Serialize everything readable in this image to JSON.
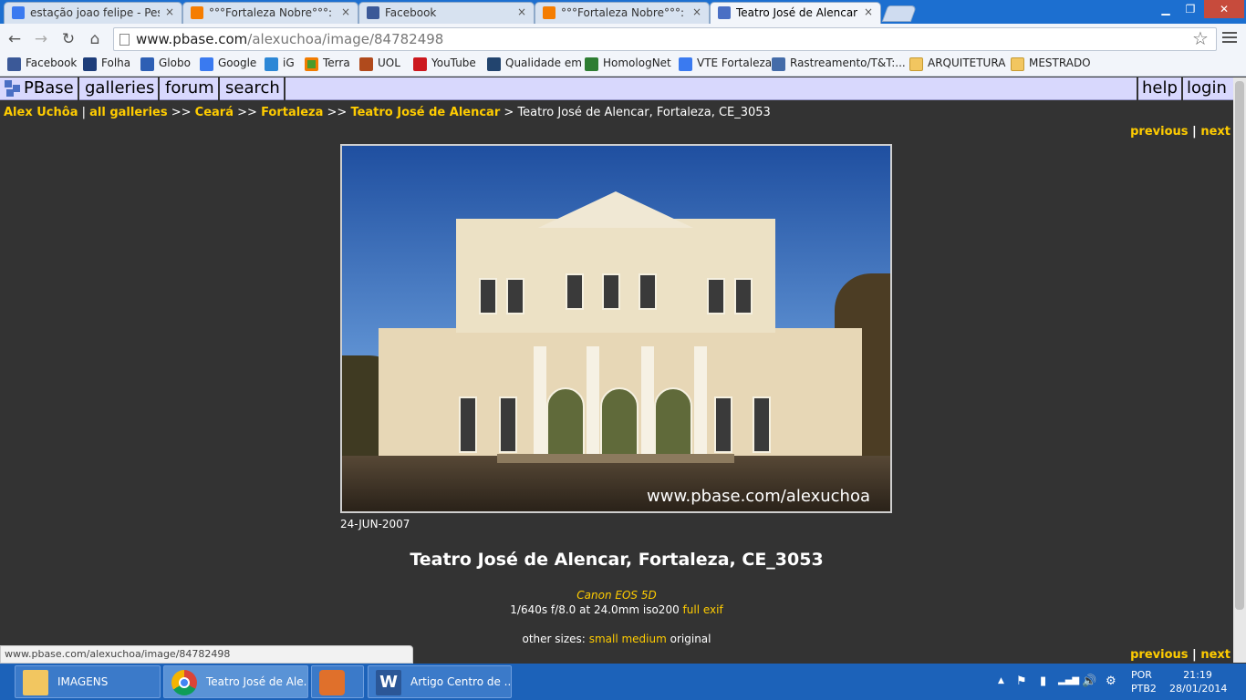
{
  "browser": {
    "tabs": [
      {
        "title": "estação joao felipe - Pesquisa",
        "favicon": "google-icon"
      },
      {
        "title": "°°°Fortaleza Nobre°°°: Pra",
        "favicon": "blogger-icon"
      },
      {
        "title": "Facebook",
        "favicon": "facebook-icon"
      },
      {
        "title": "°°°Fortaleza Nobre°°°: Pra",
        "favicon": "blogger-icon"
      },
      {
        "title": "Teatro José de Alencar, Fo",
        "favicon": "pbase-icon"
      }
    ],
    "tab_close": "×",
    "window_controls": {
      "minimize": "▁",
      "maximize": "❐",
      "close": "✕"
    },
    "nav_icons": {
      "back": "←",
      "forward": "→",
      "reload": "↻",
      "home": "⌂"
    },
    "url": {
      "host": "www.pbase.com",
      "path": "/alexuchoa/image/84782498"
    },
    "star": "☆",
    "bookmarks": [
      {
        "label": "Facebook",
        "icon": "facebook-icon"
      },
      {
        "label": "Folha",
        "icon": "folha-icon"
      },
      {
        "label": "Globo",
        "icon": "globo-icon"
      },
      {
        "label": "Google",
        "icon": "google-icon"
      },
      {
        "label": "iG",
        "icon": "ig-icon"
      },
      {
        "label": "Terra",
        "icon": "terra-icon"
      },
      {
        "label": "UOL",
        "icon": "uol-icon"
      },
      {
        "label": "YouTube",
        "icon": "youtube-icon"
      },
      {
        "label": "Qualidade em",
        "icon": "qualidade-icon"
      },
      {
        "label": "HomologNet",
        "icon": "homolognet-icon"
      },
      {
        "label": "VTE Fortaleza",
        "icon": "google-icon"
      },
      {
        "label": "Rastreamento/T&T:...",
        "icon": "rastreamento-icon"
      },
      {
        "label": "ARQUITETURA",
        "icon": "folder-icon"
      },
      {
        "label": "MESTRADO",
        "icon": "folder-icon"
      }
    ],
    "status_url": "www.pbase.com/alexuchoa/image/84782498"
  },
  "pbase_nav": {
    "logo": "PBase",
    "galleries": "galleries",
    "forum": "forum",
    "search": "search",
    "help": "help",
    "login": "login"
  },
  "breadcrumb": {
    "user": "Alex Uchôa",
    "pipe": "|",
    "all_galleries": "all galleries",
    "arrow": ">>",
    "ceara": "Ceará",
    "fortaleza": "Fortaleza",
    "teatro": "Teatro José de Alencar",
    "arrow_single": ">",
    "current": "Teatro José de Alencar, Fortaleza, CE_3053"
  },
  "pagination": {
    "previous": "previous",
    "divider": "|",
    "next": "next"
  },
  "photo": {
    "watermark": "www.pbase.com/alexuchoa",
    "date": "24-JUN-2007",
    "title": "Teatro José de Alencar, Fortaleza, CE_3053",
    "camera": "Canon EOS 5D",
    "exposure": "1/640s f/8.0 at 24.0mm iso200",
    "full_exif": "full exif",
    "other_sizes_label": "other sizes:",
    "size_small": "small",
    "size_medium": "medium",
    "size_original": "original"
  },
  "taskbar": {
    "buttons": [
      {
        "label": "IMAGENS",
        "icon": "folder-icon"
      },
      {
        "label": "Teatro José de Ale...",
        "icon": "chrome-icon"
      },
      {
        "label": "",
        "icon": "media-player-icon"
      },
      {
        "label": "Artigo Centro de ...",
        "icon": "word-icon"
      }
    ],
    "word_glyph": "W",
    "tray": {
      "up_arrow": "▲",
      "flag": "⚑",
      "battery": "▮",
      "signal": "▂▄▆",
      "volume": "🔊",
      "network": "⚙"
    },
    "lang_top": "POR",
    "lang_bottom": "PTB2",
    "time": "21:19",
    "date": "28/01/2014"
  }
}
